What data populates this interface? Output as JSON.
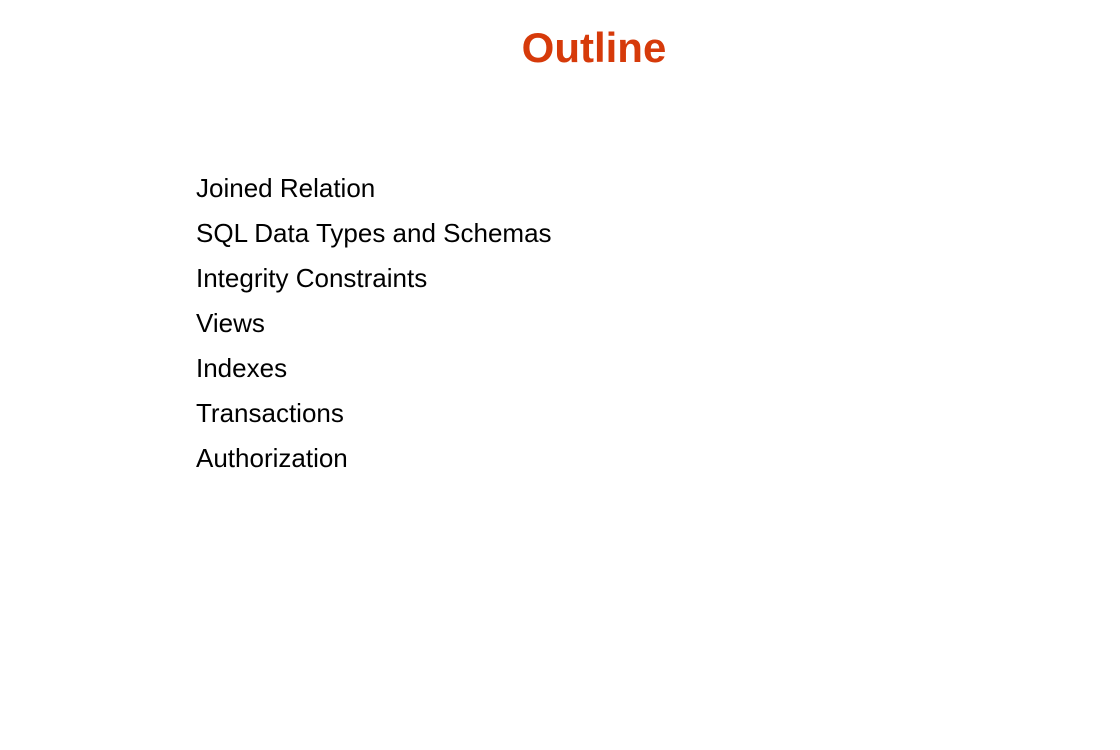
{
  "slide": {
    "title": "Outline",
    "title_color": "#d63a0a",
    "items": [
      "Joined Relation",
      "SQL Data Types and Schemas",
      "Integrity Constraints",
      "Views",
      "Indexes",
      "Transactions",
      "Authorization"
    ]
  }
}
